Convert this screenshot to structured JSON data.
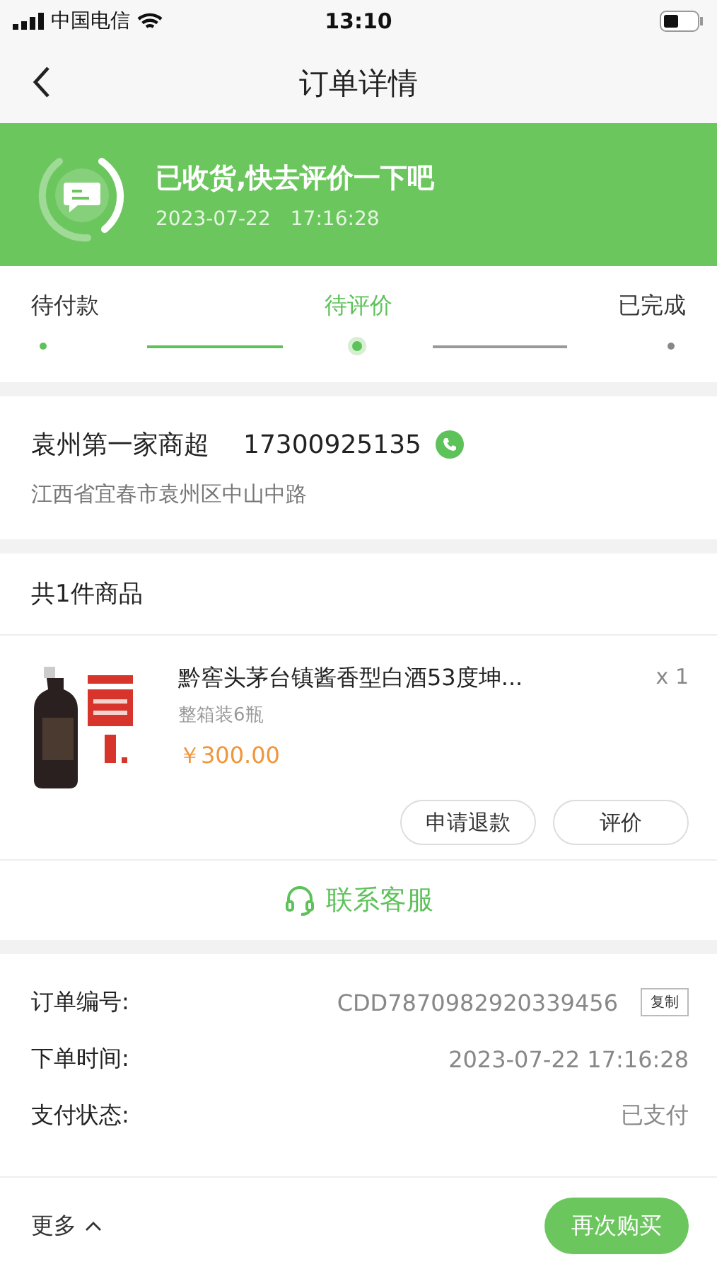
{
  "status_bar": {
    "carrier": "中国电信",
    "time": "13:10"
  },
  "nav": {
    "title": "订单详情"
  },
  "banner": {
    "title": "已收货,快去评价一下吧",
    "date": "2023-07-22",
    "time": "17:16:28"
  },
  "steps": [
    {
      "label": "待付款",
      "selected": false,
      "reached": true
    },
    {
      "label": "待评价",
      "selected": true,
      "reached": true
    },
    {
      "label": "已完成",
      "selected": false,
      "reached": false
    }
  ],
  "store": {
    "name": "袁州第一家商超",
    "phone": "17300925135",
    "address": "江西省宜春市袁州区中山中路"
  },
  "goods": {
    "heading": "共1件商品",
    "items": [
      {
        "kind": "picture",
        "name": "黔窖头茅台镇酱香型白酒53度坤...",
        "spec": "整箱装6瓶",
        "price": "￥300.00",
        "quantity": "x 1",
        "actions": [
          "申请退款",
          "评价"
        ]
      }
    ],
    "contact": "联系客服"
  },
  "info": [
    {
      "label": "订单编号:",
      "value": "CDD7870982920339456",
      "copy": "复制"
    },
    {
      "label": "下单时间:",
      "value": "2023-07-22 17:16:28"
    },
    {
      "label": "支付状态:",
      "value": "已支付"
    }
  ],
  "bottom_bar": {
    "more": "更多",
    "button": "再次购买"
  }
}
